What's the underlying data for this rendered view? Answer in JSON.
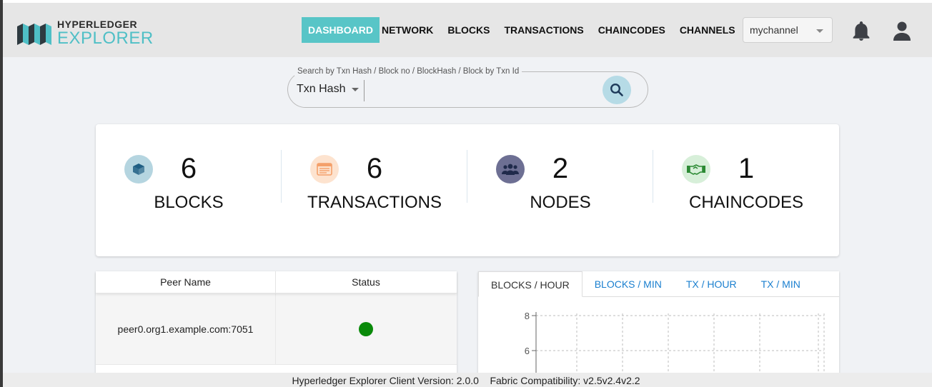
{
  "brand": {
    "line1": "HYPERLEDGER",
    "line2": "EXPLORER",
    "accent": "#58c5c7"
  },
  "nav": {
    "items": [
      {
        "label": "DASHBOARD",
        "active": true
      },
      {
        "label": "NETWORK"
      },
      {
        "label": "BLOCKS"
      },
      {
        "label": "TRANSACTIONS"
      },
      {
        "label": "CHAINCODES"
      },
      {
        "label": "CHANNELS"
      }
    ],
    "channel_selected": "mychannel",
    "icons": [
      "bell-icon",
      "user-icon"
    ]
  },
  "search": {
    "legend": "Search by Txn Hash / Block no / BlockHash / Block by Txn Id",
    "type_selected": "Txn Hash",
    "value": "",
    "button_icon": "search-icon"
  },
  "stats": [
    {
      "value": "6",
      "label": "BLOCKS",
      "icon": "cube-icon",
      "icon_bg": "#b5d5e0",
      "icon_color": "#1f5e83"
    },
    {
      "value": "6",
      "label": "TRANSACTIONS",
      "icon": "receipt-icon",
      "icon_bg": "#fde3cf",
      "icon_color": "#f4a06a"
    },
    {
      "value": "2",
      "label": "NODES",
      "icon": "users-icon",
      "icon_bg": "#6d6f93",
      "icon_color": "#1f2a4b"
    },
    {
      "value": "1",
      "label": "CHAINCODES",
      "icon": "handshake-icon",
      "icon_bg": "#d7efd9",
      "icon_color": "#2c8a34"
    }
  ],
  "peers": {
    "headers": [
      "Peer Name",
      "Status"
    ],
    "rows": [
      {
        "name": "peer0.org1.example.com:7051",
        "status": "running",
        "status_color": "#0a8a0a"
      }
    ]
  },
  "chart_tabs": [
    {
      "label": "BLOCKS / HOUR",
      "active": true
    },
    {
      "label": "BLOCKS / MIN"
    },
    {
      "label": "TX / HOUR"
    },
    {
      "label": "TX / MIN"
    }
  ],
  "chart_data": {
    "type": "line",
    "title": "",
    "xlabel": "",
    "ylabel": "",
    "y_ticks": [
      "8",
      "6"
    ],
    "grid": true
  },
  "footer": {
    "text": "Hyperledger Explorer Client Version: 2.0.0    Fabric Compatibility: v2.5v2.4v2.2"
  }
}
